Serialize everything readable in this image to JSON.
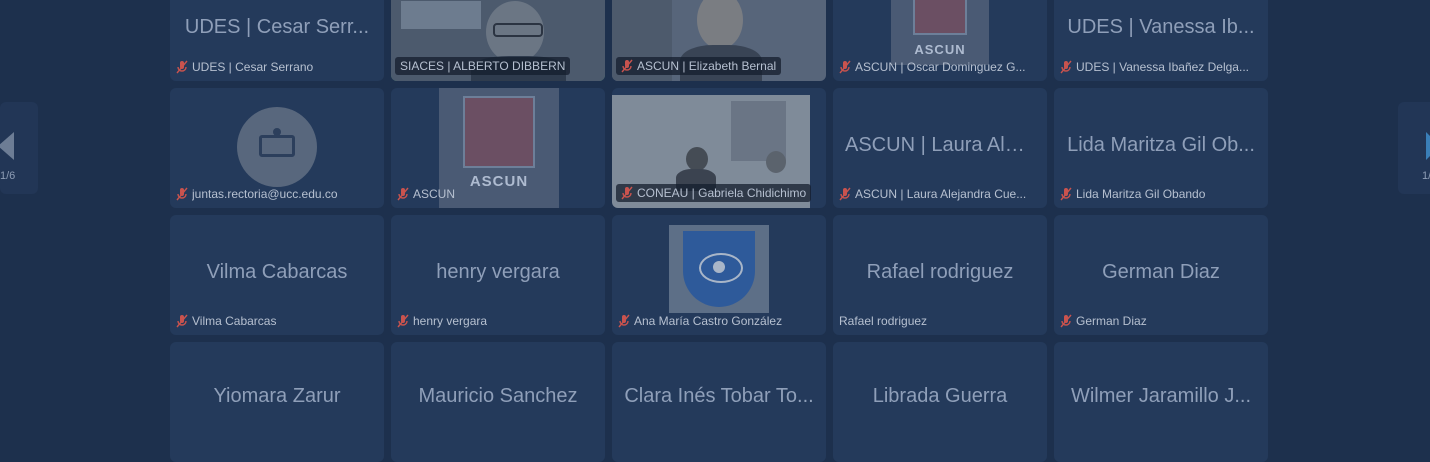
{
  "navigation": {
    "page_indicator": "1/6",
    "page_indicator_right": "1/"
  },
  "participants": [
    {
      "big_name": "UDES | Cesar Serr...",
      "label": "UDES | Cesar Serrano",
      "muted": true
    },
    {
      "big_name": "",
      "label": "SIACES | ALBERTO DIBBERN",
      "muted": false,
      "video": true,
      "active": true
    },
    {
      "big_name": "",
      "label": "ASCUN | Elizabeth Bernal",
      "muted": true,
      "video": true
    },
    {
      "big_name": "",
      "label": "ASCUN | Oscar Dominguez G...",
      "muted": true,
      "logo": "ascun"
    },
    {
      "big_name": "UDES | Vanessa Ib...",
      "label": "UDES | Vanessa Ibañez Delga...",
      "muted": true
    },
    {
      "big_name": "",
      "label": "juntas.rectoria@ucc.edu.co",
      "muted": true,
      "avatar": true
    },
    {
      "big_name": "",
      "label": "ASCUN",
      "muted": true,
      "logo": "ascun",
      "logo_word": "ASCUN"
    },
    {
      "big_name": "",
      "label": "CONEAU | Gabriela Chidichimo",
      "muted": true,
      "video": true
    },
    {
      "big_name": "ASCUN | Laura Alej...",
      "label": "ASCUN | Laura Alejandra Cue...",
      "muted": true
    },
    {
      "big_name": "Lida Maritza Gil Ob...",
      "label": "Lida Maritza Gil Obando",
      "muted": true
    },
    {
      "big_name": "Vilma Cabarcas",
      "label": "Vilma Cabarcas",
      "muted": true
    },
    {
      "big_name": "henry vergara",
      "label": "henry vergara",
      "muted": true
    },
    {
      "big_name": "",
      "label": "Ana María Castro González",
      "muted": true,
      "logo": "university"
    },
    {
      "big_name": "Rafael rodriguez",
      "label": "Rafael rodriguez",
      "muted": false
    },
    {
      "big_name": "German Diaz",
      "label": "German Diaz",
      "muted": true
    },
    {
      "big_name": "Yiomara Zarur",
      "label": "",
      "muted": false
    },
    {
      "big_name": "Mauricio Sanchez",
      "label": "",
      "muted": false
    },
    {
      "big_name": "Clara Inés Tobar To...",
      "label": "",
      "muted": false
    },
    {
      "big_name": "Librada Guerra",
      "label": "",
      "muted": false
    },
    {
      "big_name": "Wilmer Jaramillo J...",
      "label": "",
      "muted": false
    }
  ],
  "colors": {
    "background": "#1d304d",
    "tile": "#243a5b",
    "muted_icon": "#d9534f",
    "active_border": "#3f8a6a"
  },
  "icons": {
    "muted": "muted-mic-icon",
    "prev": "prev-page-arrow-icon",
    "next": "next-page-arrow-icon",
    "avatar": "webcam-avatar-icon"
  }
}
